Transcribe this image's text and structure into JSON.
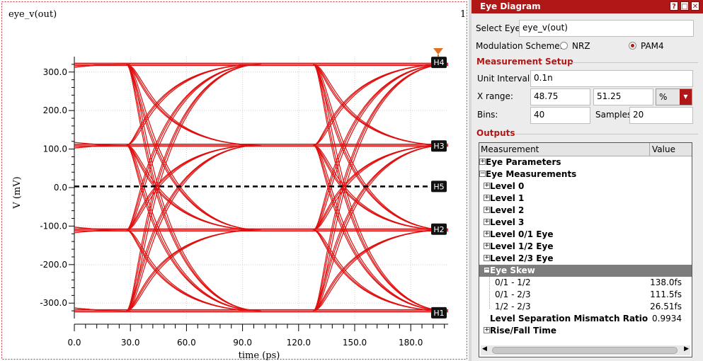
{
  "plot": {
    "trace_title": "eye_v(out)",
    "corner_text": "1",
    "ylabel": "V (mV)",
    "xlabel": "time (ps)",
    "y_ticks": [
      "300.0",
      "200.0",
      "100.0",
      "0.0",
      "-100.0",
      "-200.0",
      "-300.0"
    ],
    "x_ticks": [
      "0.0",
      "30.0",
      "60.0",
      "90.0",
      "120.0",
      "150.0",
      "180.0"
    ],
    "markers": [
      "H4",
      "H3",
      "H5",
      "H2",
      "H1"
    ],
    "trace_color": "#e01010"
  },
  "chart_data": {
    "type": "line",
    "title": "eye_v(out)",
    "xlabel": "time (ps)",
    "ylabel": "V (mV)",
    "xlim": [
      0,
      200
    ],
    "ylim": [
      -340,
      340
    ],
    "grid": true,
    "levels_mV": [
      -320,
      -110,
      110,
      320
    ],
    "transition_times_ps": [
      30,
      130
    ],
    "series": [
      {
        "name": "H4",
        "values": [
          325,
          325
        ]
      },
      {
        "name": "H3",
        "values": [
          108,
          108
        ]
      },
      {
        "name": "H5",
        "values": [
          3,
          3
        ]
      },
      {
        "name": "H2",
        "values": [
          -108,
          -108
        ]
      },
      {
        "name": "H1",
        "values": [
          -325,
          -325
        ]
      }
    ]
  },
  "panel": {
    "title": "Eye Diagram",
    "title_buttons": [
      "?",
      "□",
      "✕"
    ],
    "select_eye_label": "Select Eye:",
    "select_eye_value": "eye_v(out)",
    "modulation_label": "Modulation Scheme:",
    "nrz_label": "NRZ",
    "pam4_label": "PAM4",
    "measurement_setup": "Measurement Setup",
    "unit_interval_label": "Unit Interval:",
    "unit_interval_value": "0.1n",
    "x_range_label": "X range:",
    "x_range_from": "48.75",
    "x_range_to": "51.25",
    "x_range_unit": "%",
    "bins_label": "Bins:",
    "bins_value": "40",
    "samples_label": "Samples:",
    "samples_value": "20",
    "outputs": "Outputs",
    "col_measurement": "Measurement",
    "col_value": "Value",
    "rows": [
      {
        "name": "Eye Parameters",
        "value": ""
      },
      {
        "name": "Eye Measurements",
        "value": ""
      },
      {
        "name": "Level 0",
        "value": ""
      },
      {
        "name": "Level 1",
        "value": ""
      },
      {
        "name": "Level 2",
        "value": ""
      },
      {
        "name": "Level 3",
        "value": ""
      },
      {
        "name": "Level 0/1 Eye",
        "value": ""
      },
      {
        "name": "Level 1/2 Eye",
        "value": ""
      },
      {
        "name": "Level 2/3 Eye",
        "value": ""
      },
      {
        "name": "Eye Skew",
        "value": ""
      },
      {
        "name": "0/1 - 1/2",
        "value": "138.0fs"
      },
      {
        "name": "0/1 - 2/3",
        "value": "111.5fs"
      },
      {
        "name": "1/2 - 2/3",
        "value": "26.51fs"
      },
      {
        "name": "Level Separation Mismatch Ratio",
        "value": "0.9934"
      },
      {
        "name": "Rise/Fall Time",
        "value": ""
      }
    ]
  }
}
